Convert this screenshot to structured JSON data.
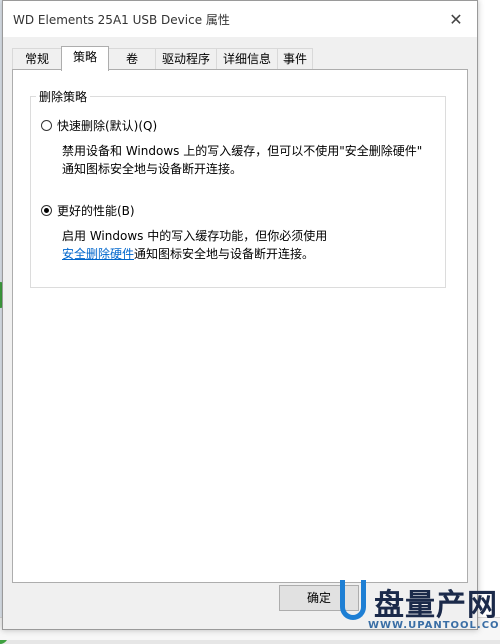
{
  "window": {
    "title": "WD Elements 25A1 USB Device 属性",
    "close_glyph": "✕"
  },
  "tabs": [
    {
      "label": "常规",
      "active": false
    },
    {
      "label": "策略",
      "active": true
    },
    {
      "label": "卷",
      "active": false
    },
    {
      "label": "驱动程序",
      "active": false
    },
    {
      "label": "详细信息",
      "active": false
    },
    {
      "label": "事件",
      "active": false
    }
  ],
  "removal_policy": {
    "group_title": "删除策略",
    "options": [
      {
        "label": "快速删除(默认)(Q)",
        "checked": false,
        "desc_line1": "禁用设备和 Windows 上的写入缓存，但可以不使用\"安全删除硬件\"",
        "desc_line2": "通知图标安全地与设备断开连接。"
      },
      {
        "label": "更好的性能(B)",
        "checked": true,
        "desc_line1": "启用 Windows 中的写入缓存功能，但你必须使用",
        "desc_link": "安全删除硬件",
        "desc_line2_rest": "通知图标安全地与设备断开连接。"
      }
    ]
  },
  "buttons": {
    "ok_label": "确定"
  },
  "watermark": {
    "brand": "盘量产网",
    "url": "WWW.UPANTOOL.COM"
  },
  "colors": {
    "link": "#0066cc",
    "watermark_blue": "#1e7fd4",
    "watermark_dark": "#1b2a4a",
    "background_green": "#3fa140"
  }
}
